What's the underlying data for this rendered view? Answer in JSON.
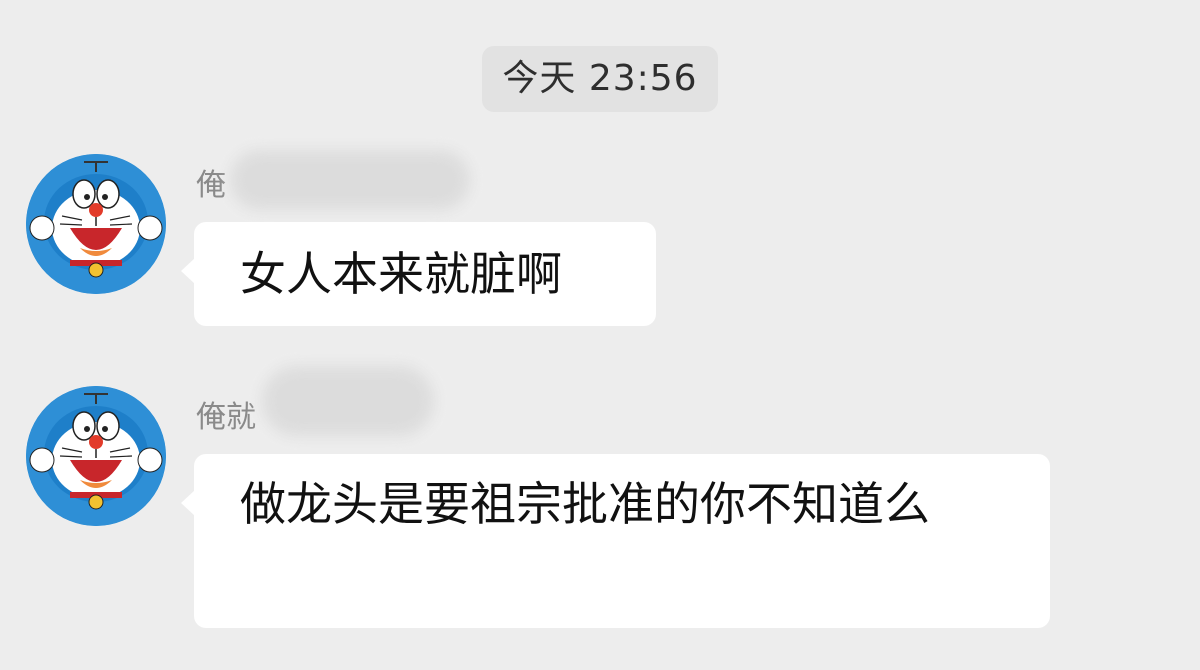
{
  "timestamp": "今天 23:56",
  "messages": [
    {
      "sender": "俺",
      "avatar_icon": "doraemon-avatar-icon",
      "text": "女人本来就脏啊"
    },
    {
      "sender": "俺就",
      "avatar_icon": "doraemon-avatar-icon",
      "text": "做龙头是要祖宗批准的你不知道么"
    }
  ],
  "colors": {
    "background": "#ededed",
    "bubble": "#ffffff",
    "timestamp_bg": "#e2e2e2",
    "sender_text": "#8a8a8a",
    "avatar_blue": "#2e8fd6"
  }
}
